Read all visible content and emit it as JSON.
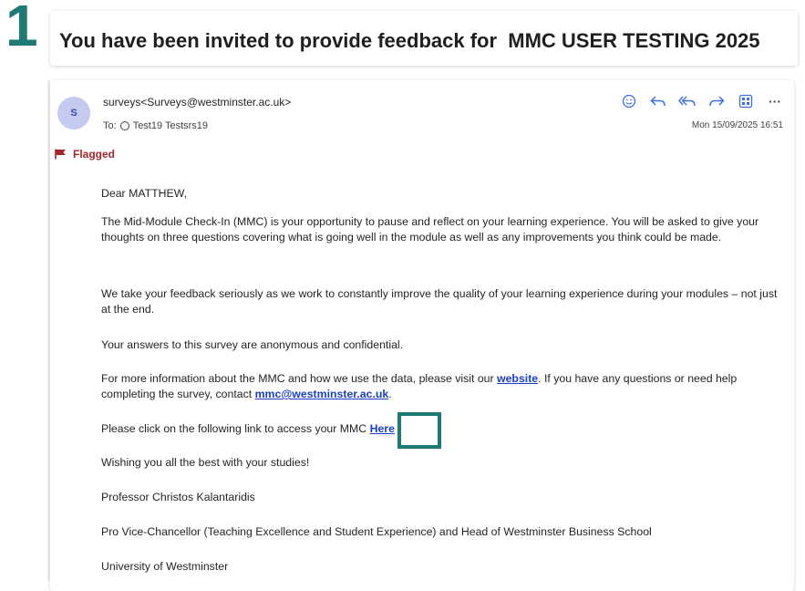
{
  "step": "1",
  "subject": "You have been invited to provide feedback for  MMC USER TESTING 2025",
  "message": {
    "avatar_initial": "S",
    "sender": "surveys<Surveys@westminster.ac.uk>",
    "to_label": "To:",
    "to_name": "Test19 Testsrs19",
    "date": "Mon 15/09/2025 16:51",
    "flag_label": "Flagged",
    "toolbar_icons": [
      "smiley-icon",
      "reply-icon",
      "reply-all-icon",
      "forward-icon",
      "apps-icon",
      "more-icon"
    ],
    "more_label": "···"
  },
  "body": {
    "greeting": "Dear MATTHEW,",
    "p1": "The Mid-Module Check-In (MMC) is your opportunity to pause and reflect on your learning experience. You will be asked to give your thoughts on three questions covering what is going well in the module as well as any improvements you think could be made.",
    "p2": "We take your feedback seriously as we work to constantly improve the quality of your learning experience during your modules – not just at the end.",
    "p3": "Your answers to this survey are anonymous and confidential.",
    "p4_part1": "For more information about the MMC and how we use the data, please visit our ",
    "p4_link1": "website",
    "p4_part2": ". If you have any questions or need help completing the survey, contact ",
    "p4_link2": "mmc@westminster.ac.uk",
    "p4_part3": ".",
    "p5_text": "Please click on the following link to access your MMC ",
    "p5_link": "Here",
    "p6": "Wishing you all the best with your studies!",
    "p7": "Professor Christos Kalantaridis",
    "p8": "Pro Vice-Chancellor (Teaching Excellence and Student Experience) and Head of Westminster Business School",
    "p9": "University of Westminster"
  },
  "colors": {
    "accent_teal": "#1e7b73",
    "link_blue": "#1a3fc9",
    "flag_red": "#a4262c",
    "icon_blue": "#3c6df0"
  }
}
